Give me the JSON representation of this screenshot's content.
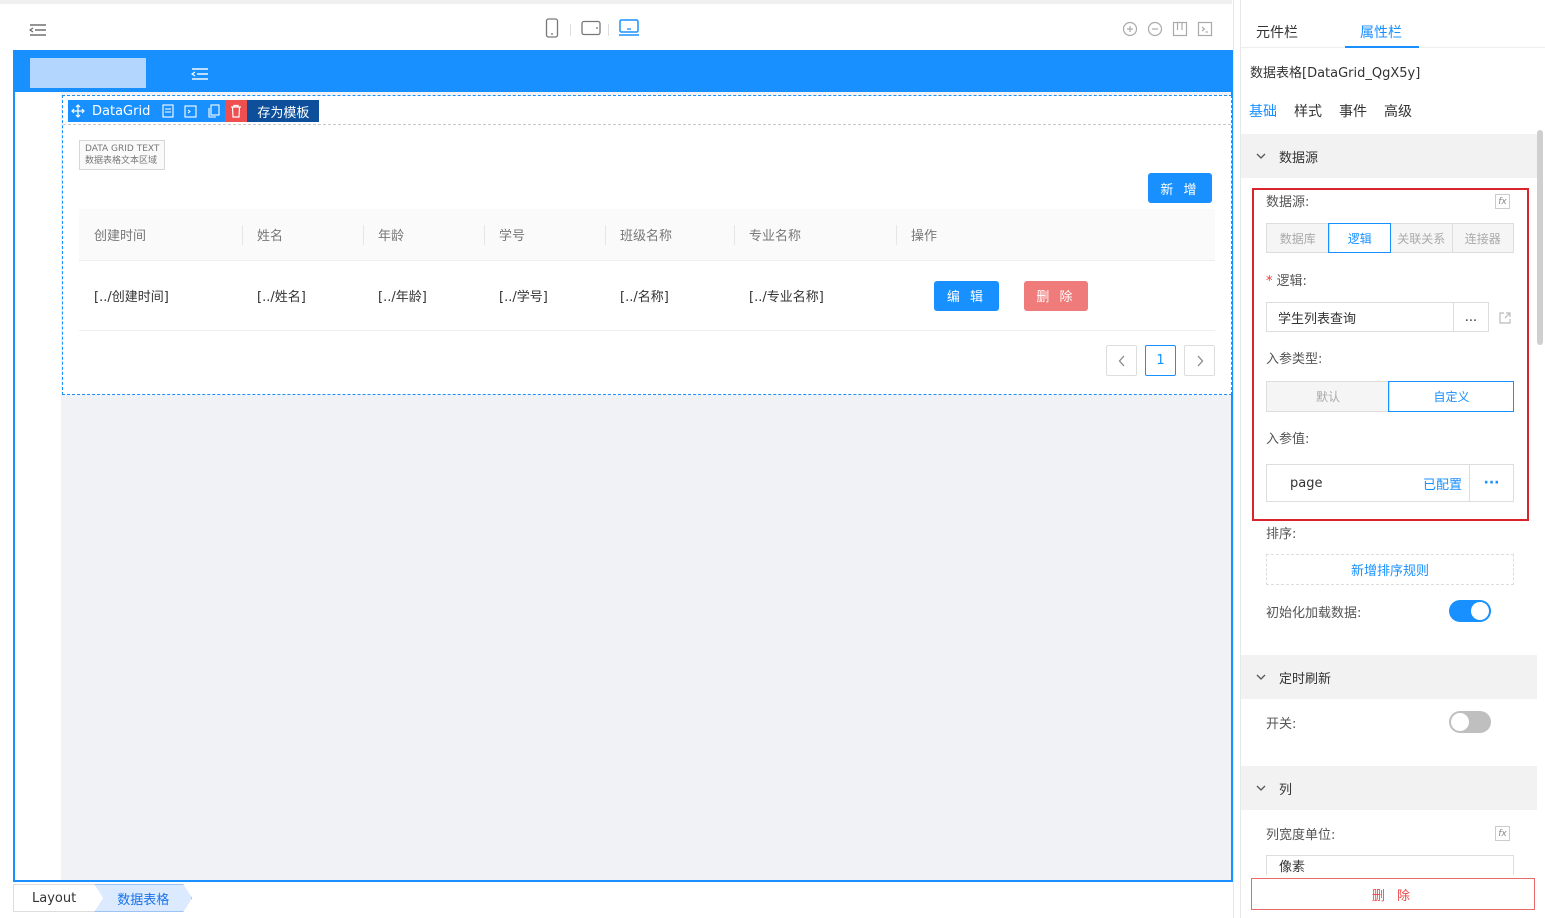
{
  "toolbar": {
    "icons": [
      "menu-fold-icon",
      "mobile-icon",
      "tablet-icon",
      "desktop-icon",
      "zoom-in-icon",
      "zoom-out-icon",
      "layout-icon",
      "code-icon"
    ],
    "accent": "#1890ff"
  },
  "canvas": {
    "component": {
      "label": "DataGrid",
      "save_template": "存为模板",
      "text_badge_line1": "DATA GRID TEXT",
      "text_badge_line2": "数据表格文本区域",
      "add_button": "新 增",
      "columns": [
        "创建时间",
        "姓名",
        "年龄",
        "学号",
        "班级名称",
        "专业名称",
        "操作"
      ],
      "row": [
        "[../创建时间]",
        "[../姓名]",
        "[../年龄]",
        "[../学号]",
        "[../名称]",
        "[../专业名称]"
      ],
      "edit_button": "编 辑",
      "delete_button": "删 除",
      "page": "1"
    }
  },
  "breadcrumb": [
    "Layout",
    "数据表格"
  ],
  "panel": {
    "tabs": [
      "元件栏",
      "属性栏"
    ],
    "title": "数据表格[DataGrid_QgX5y]",
    "sub_tabs": [
      "基础",
      "样式",
      "事件",
      "高级"
    ],
    "sections": {
      "datasource": "数据源",
      "timer": "定时刷新",
      "columns": "列"
    },
    "fields": {
      "datasource_label": "数据源:",
      "datasource_options": [
        "数据库",
        "逻辑",
        "关联关系",
        "连接器"
      ],
      "logic_label": "逻辑:",
      "logic_value": "学生列表查询",
      "logic_more": "...",
      "param_type_label": "入参类型:",
      "param_type_options": [
        "默认",
        "自定义"
      ],
      "param_value_label": "入参值:",
      "param_name": "page",
      "param_state": "已配置",
      "param_more": "···",
      "sort_label": "排序:",
      "sort_add": "新增排序规则",
      "init_load_label": "初始化加载数据:",
      "init_load": true,
      "switch_label": "开关:",
      "switch_on": false,
      "col_width_label": "列宽度单位:",
      "col_width_value": "像素",
      "fx": "fx"
    },
    "delete_button": "删 除"
  }
}
